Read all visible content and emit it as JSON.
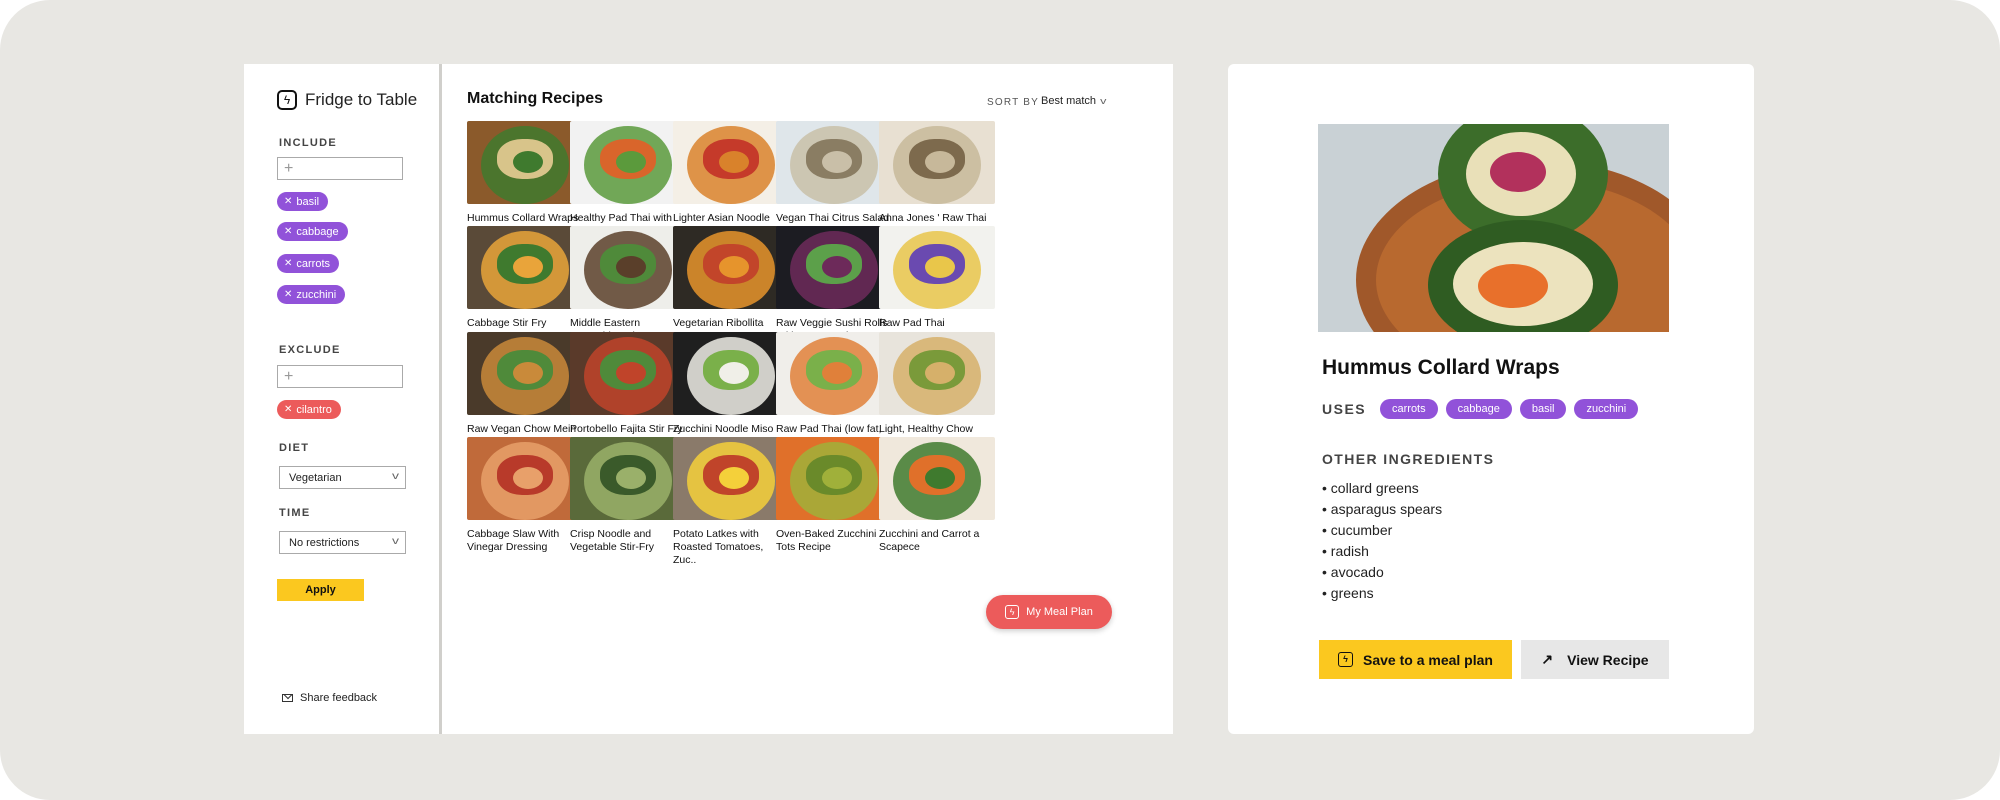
{
  "app": {
    "brand": "Fridge to Table",
    "brand_icon": "bolt-icon"
  },
  "sidebar": {
    "include_label": "INCLUDE",
    "include_placeholder": "+",
    "include_chips": [
      "basil",
      "cabbage",
      "carrots",
      "zucchini"
    ],
    "exclude_label": "EXCLUDE",
    "exclude_placeholder": "+",
    "exclude_chips": [
      "cilantro"
    ],
    "diet_label": "DIET",
    "diet_value": "Vegetarian",
    "time_label": "TIME",
    "time_value": "No restrictions",
    "apply_label": "Apply",
    "feedback_label": "Share feedback"
  },
  "main": {
    "title": "Matching Recipes",
    "sort_label": "SORT BY",
    "sort_value": "Best match",
    "meal_plan_label": "My Meal Plan",
    "recipes": [
      "Hummus Collard Wraps",
      "Healthy Pad Thai with Peanut Sauce",
      "Lighter Asian Noodle Salad",
      "Vegan Thai Citrus Salad",
      "Anna Jones ' Raw Thai Citrus Crunch Salad",
      "Cabbage Stir Fry",
      "Middle Eastern Vegetable Bake",
      "Vegetarian Ribollita",
      "Raw Veggie Sushi Rolls With Homemade Hummus",
      "Raw Pad Thai",
      "Raw Vegan Chow Mein",
      "Portobello Fajita Stir Fry",
      "Zucchini Noodle Miso Ramen (vegan, gluten-f...",
      "Raw Pad Thai (low fat, vegan)",
      "Light, Healthy Chow Mein Made with Zuc...",
      "Cabbage Slaw With Vinegar Dressing",
      "Crisp Noodle and Vegetable Stir-Fry",
      "Potato Latkes with Roasted Tomatoes, Zuc..",
      "Oven-Baked Zucchini Tots Recipe",
      "Zucchini and Carrot a Scapece"
    ]
  },
  "detail": {
    "title": "Hummus Collard Wraps",
    "uses_label": "USES",
    "uses": [
      "carrots",
      "cabbage",
      "basil",
      "zucchini"
    ],
    "other_label": "OTHER INGREDIENTS",
    "ingredients": [
      "collard greens",
      "asparagus spears",
      "cucumber",
      "radish",
      "avocado",
      "greens"
    ],
    "save_label": "Save to a meal plan",
    "view_label": "View Recipe"
  },
  "colors": {
    "accent_yellow": "#fbc81f",
    "chip_purple": "#9152d9",
    "chip_red": "#ec5b5b",
    "backdrop": "#e8e7e3"
  }
}
